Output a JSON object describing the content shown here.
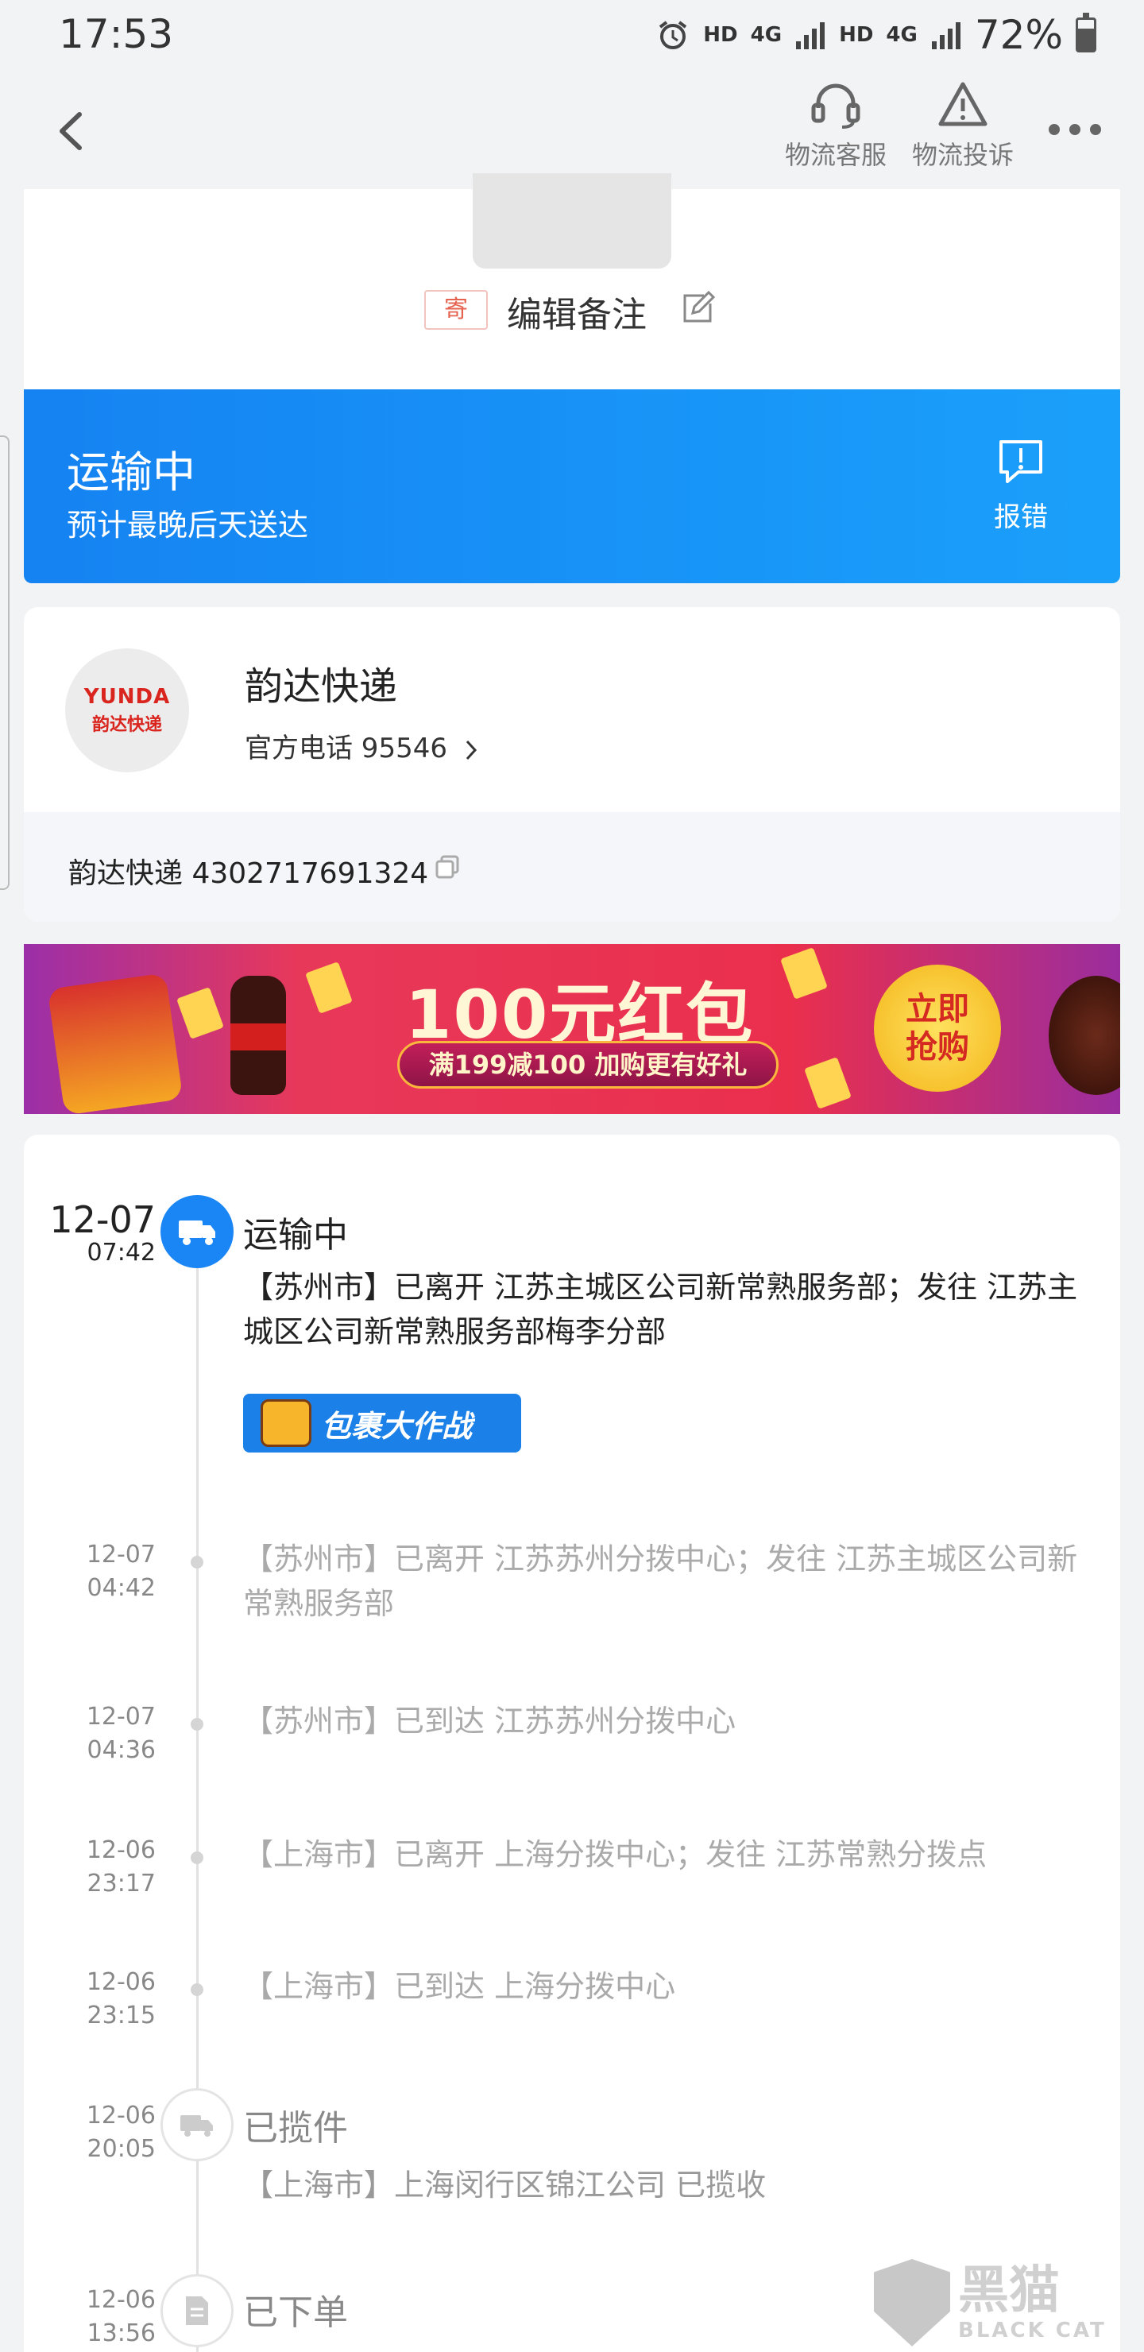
{
  "status_bar": {
    "time": "17:53",
    "hd1": "HD",
    "net1": "4G",
    "hd2": "HD",
    "net2": "4G",
    "battery": "72%",
    "battery_level": 0.72
  },
  "nav": {
    "customer_service": "物流客服",
    "complaint": "物流投诉",
    "icons": {
      "back": "back-arrow-icon",
      "service": "headset-icon",
      "complaint": "warning-triangle-icon",
      "more": "more-dots-icon"
    }
  },
  "package": {
    "sender_tag": "寄",
    "edit_note": "编辑备注"
  },
  "status": {
    "title": "运输中",
    "subtitle": "预计最晚后天送达",
    "report_label": "报错"
  },
  "carrier": {
    "logo_en": "YUNDA",
    "logo_cn": "韵达快递",
    "name": "韵达快递",
    "phone_label": "官方电话 95546",
    "tracking_line": "韵达快递 4302717691324"
  },
  "ad": {
    "title": "100元红包",
    "subtitle": "满199减100 加购更有好礼",
    "button": "立即抢购"
  },
  "timeline": {
    "current": {
      "date": "12-07",
      "time": "07:42",
      "title": "运输中",
      "text": "【苏州市】已离开 江苏主城区公司新常熟服务部；发往 江苏主城区公司新常熟服务部梅李分部",
      "game_label": "包裹大作战"
    },
    "events": [
      {
        "date": "12-07",
        "time": "04:42",
        "text": "【苏州市】已离开 江苏苏州分拨中心；发往 江苏主城区公司新常熟服务部"
      },
      {
        "date": "12-07",
        "time": "04:36",
        "text": "【苏州市】已到达 江苏苏州分拨中心"
      },
      {
        "date": "12-06",
        "time": "23:17",
        "text": "【上海市】已离开 上海分拨中心；发往 江苏常熟分拨点"
      },
      {
        "date": "12-06",
        "time": "23:15",
        "text": "【上海市】已到达 上海分拨中心"
      }
    ],
    "pickup": {
      "date": "12-06",
      "time": "20:05",
      "title": "已揽件",
      "text": "【上海市】上海闵行区锦江公司 已揽收"
    },
    "order": {
      "date": "12-06",
      "time": "13:56",
      "title": "已下单"
    }
  },
  "watermark": {
    "cn": "黑猫",
    "en": "BLACK CAT"
  },
  "colors": {
    "primary": "#1a86f5",
    "muted": "#aaaaaa",
    "red_tag": "#e5624f"
  }
}
